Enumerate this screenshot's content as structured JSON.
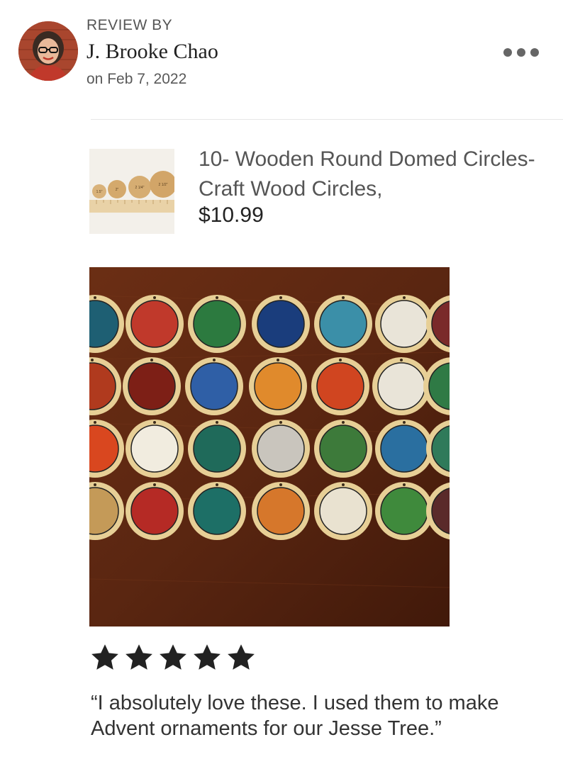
{
  "reviewer": {
    "label": "REVIEW BY",
    "name": "J. Brooke Chao",
    "date": "on Feb 7, 2022"
  },
  "menu": {
    "icon": "more-horizontal-icon"
  },
  "product": {
    "title": "10- Wooden Round Domed Circles- Craft Wood Circles,",
    "price": "$10.99",
    "thumb_labels": [
      "1.5\"",
      "2\"",
      "2 1/4\"",
      "2 1/2\""
    ]
  },
  "rating": {
    "stars": 5,
    "max": 5,
    "color": "#222222"
  },
  "review": {
    "text": "“I absolutely love these.  I used them to make Advent ornaments for our Jesse Tree.”"
  },
  "colors": {
    "text": "#222222",
    "muted": "#595959",
    "divider": "#e6e6e6",
    "wood_table": "#5a2611"
  }
}
